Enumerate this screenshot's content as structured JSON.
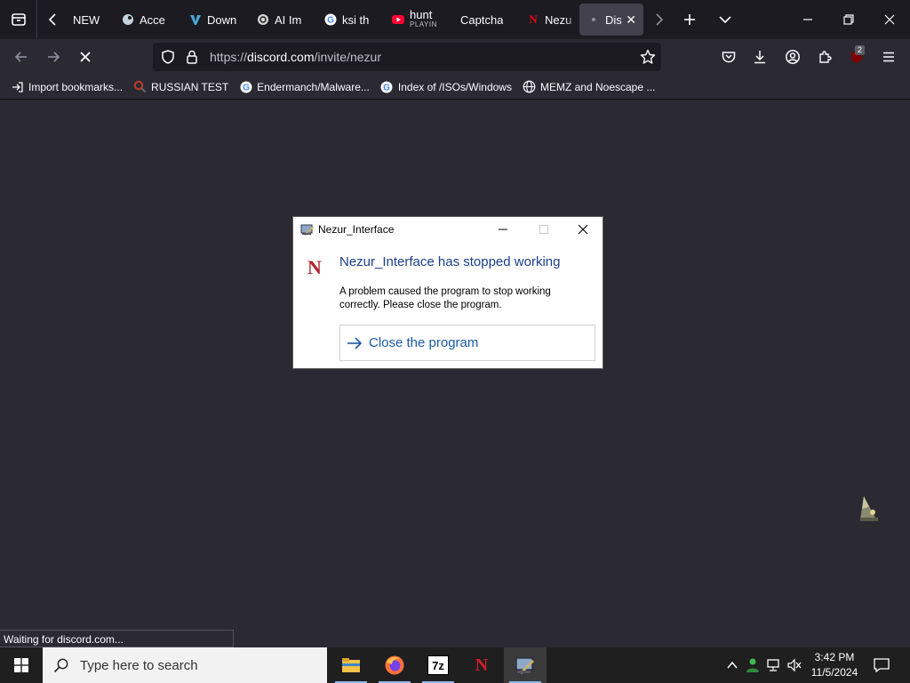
{
  "browser": {
    "tabs": [
      {
        "label": "NEW",
        "favicon": "none",
        "active": false
      },
      {
        "label": "Acce",
        "favicon": "steam-icon",
        "active": false
      },
      {
        "label": "Down",
        "favicon": "vs-icon",
        "active": false
      },
      {
        "label": "AI Im",
        "favicon": "openai-icon",
        "active": false
      },
      {
        "label": "ksi th",
        "favicon": "google-icon",
        "active": false
      },
      {
        "label": "hunt",
        "sublabel": "PLAYIN",
        "favicon": "youtube-icon",
        "active": false
      },
      {
        "label": "Captcha",
        "favicon": "none",
        "active": false
      },
      {
        "label": "Nezu",
        "favicon": "netflix-icon",
        "active": false
      },
      {
        "label": "Dis",
        "favicon": "loading-dot",
        "active": true
      }
    ],
    "url": {
      "prefix": "https://",
      "domain": "discord.com",
      "path": "/invite/nezur"
    },
    "extension_badge": "2",
    "bookmarks": [
      {
        "label": "Import bookmarks...",
        "icon": "import-icon"
      },
      {
        "label": "RUSSIAN TEST",
        "icon": "magnifier-icon"
      },
      {
        "label": "Endermanch/Malware...",
        "icon": "google-icon"
      },
      {
        "label": "Index of /ISOs/Windows",
        "icon": "google-icon"
      },
      {
        "label": "MEMZ and Noescape ...",
        "icon": "globe-icon"
      }
    ],
    "status": "Waiting for discord.com..."
  },
  "dialog": {
    "title": "Nezur_Interface",
    "heading": "Nezur_Interface has stopped working",
    "message": "A problem caused the program to stop working correctly. Please close the program.",
    "action": "Close the program",
    "brand_letter": "N"
  },
  "taskbar": {
    "search_placeholder": "Type here to search",
    "time": "3:42 PM",
    "date": "11/5/2024",
    "apps": [
      "file-explorer-icon",
      "firefox-icon",
      "7zip-icon",
      "nezur-icon",
      "nezur-interface-icon"
    ],
    "seven_zip_label": "7z",
    "nezur_label": "N"
  },
  "colors": {
    "accent_red": "#b0252f",
    "dialog_heading": "#1c3d8c",
    "link_blue": "#1a5aa8"
  }
}
